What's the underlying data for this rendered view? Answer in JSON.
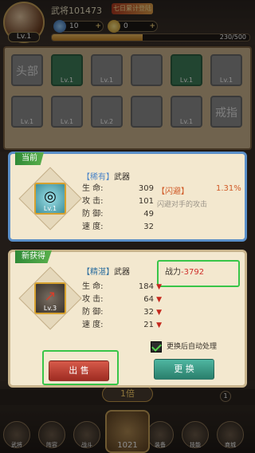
{
  "top": {
    "player_name": "武将101473",
    "vip": "七日累计登陆",
    "level": "Lv.1",
    "gem": "10",
    "gold": "0",
    "exp_text": "230/500",
    "exp_fraction": 0.46
  },
  "equip_slots": [
    {
      "label": "头部",
      "lv": "",
      "style": "gray"
    },
    {
      "label": "",
      "lv": "Lv.1",
      "style": "green"
    },
    {
      "label": "",
      "lv": "Lv.1",
      "style": "gray"
    },
    {
      "label": "",
      "lv": "",
      "style": "gray"
    },
    {
      "label": "",
      "lv": "Lv.1",
      "style": "green"
    },
    {
      "label": "",
      "lv": "Lv.1",
      "style": "gray"
    },
    {
      "label": "",
      "lv": "Lv.1",
      "style": "gray"
    },
    {
      "label": "",
      "lv": "Lv.1",
      "style": "gray"
    },
    {
      "label": "",
      "lv": "Lv.2",
      "style": "gray"
    },
    {
      "label": "",
      "lv": "",
      "style": "gray"
    },
    {
      "label": "",
      "lv": "Lv.1",
      "style": "gray"
    },
    {
      "label": "戒指",
      "lv": "",
      "style": "gray"
    }
  ],
  "current": {
    "tag": "当前",
    "item_name_prefix": "【稀有】",
    "item_name_type": "武器",
    "item_lv": "Lv.1",
    "stats": [
      {
        "label": "生 命:",
        "value": "309"
      },
      {
        "label": "攻 击:",
        "value": "101"
      },
      {
        "label": "防 御:",
        "value": "49"
      },
      {
        "label": "速 度:",
        "value": "32"
      }
    ],
    "special_title": "【闪避】",
    "special_pct": "1.31%",
    "special_desc": "闪避对手的攻击"
  },
  "new_item": {
    "tag": "新获得",
    "item_name_prefix": "【精湛】",
    "item_name_type": "武器",
    "item_lv": "Lv.3",
    "power_label": "战力",
    "power_value": "-3792",
    "stats": [
      {
        "label": "生 命:",
        "value": "184"
      },
      {
        "label": "攻 击:",
        "value": "64"
      },
      {
        "label": "防 御:",
        "value": "32"
      },
      {
        "label": "速 度:",
        "value": "21"
      }
    ],
    "auto_process_label": "更换后自动处理",
    "auto_process_checked": true,
    "sell_button": "出 售",
    "swap_button": "更 换"
  },
  "bottom": {
    "rank_text": "1倍",
    "badge": "1",
    "center_value": "1021",
    "icons": [
      {
        "label": "武将"
      },
      {
        "label": "阵容"
      },
      {
        "label": "战斗"
      },
      {
        "label": "装备"
      },
      {
        "label": "技能"
      },
      {
        "label": "商城"
      },
      {
        "label": "背包"
      }
    ]
  }
}
